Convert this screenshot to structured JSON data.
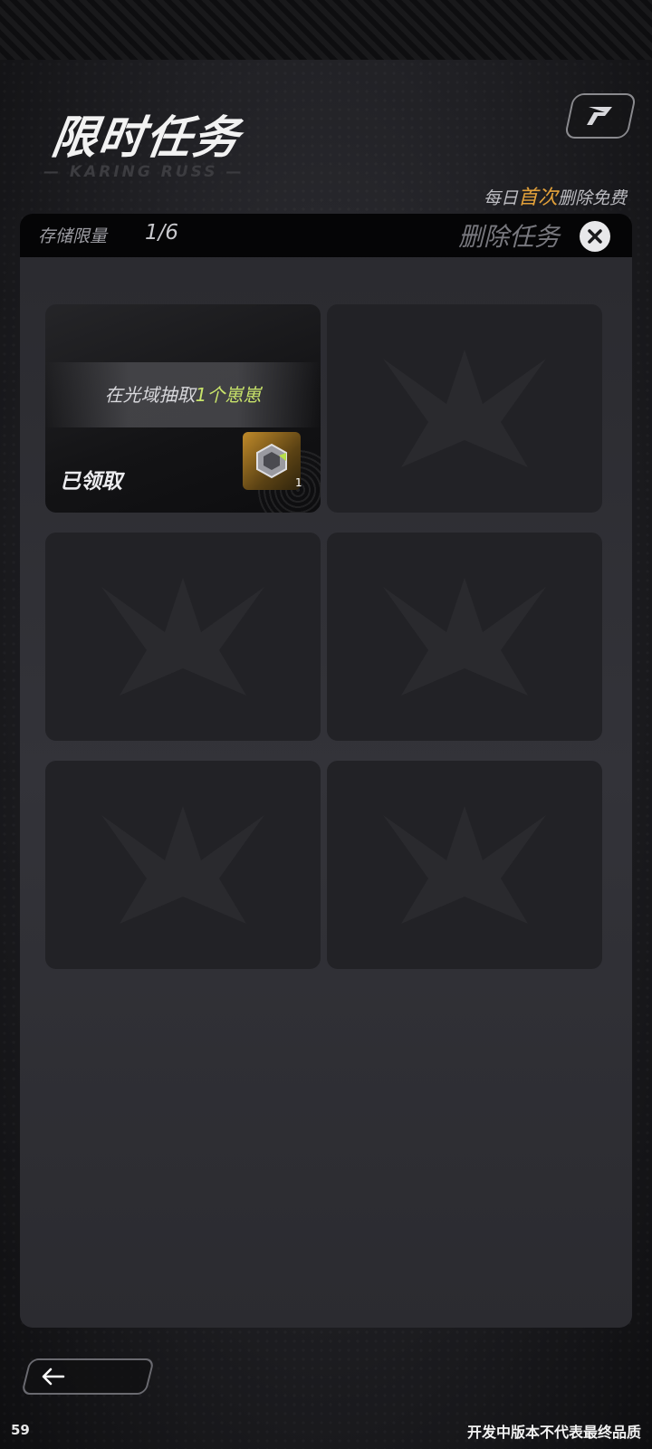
{
  "header": {
    "title": "限时任务",
    "subtitle": "— KARING RUSS —"
  },
  "daily_note": {
    "prefix": "每日",
    "highlight": "首次",
    "suffix": "删除免费"
  },
  "storage": {
    "label": "存储限量",
    "value": "1/6"
  },
  "delete_task": {
    "label": "删除任务"
  },
  "task_slots": [
    {
      "filled": true,
      "task_prefix": "在光域抽取",
      "task_highlight": "1个崽崽",
      "status": "已领取",
      "reward_count": "1"
    },
    {
      "filled": false
    },
    {
      "filled": false
    },
    {
      "filled": false
    },
    {
      "filled": false
    },
    {
      "filled": false
    }
  ],
  "footer": {
    "frame_counter": "59",
    "disclaimer": "开发中版本不代表最终品质"
  },
  "colors": {
    "accent_orange": "#e3a13a",
    "accent_green": "#c8e36a"
  },
  "icons": {
    "corner": "brand-logo-icon",
    "delete": "close-icon",
    "back": "arrow-left-icon",
    "slot_placeholder": "emblem-watermark-icon",
    "reward": "gem-crate-icon"
  }
}
